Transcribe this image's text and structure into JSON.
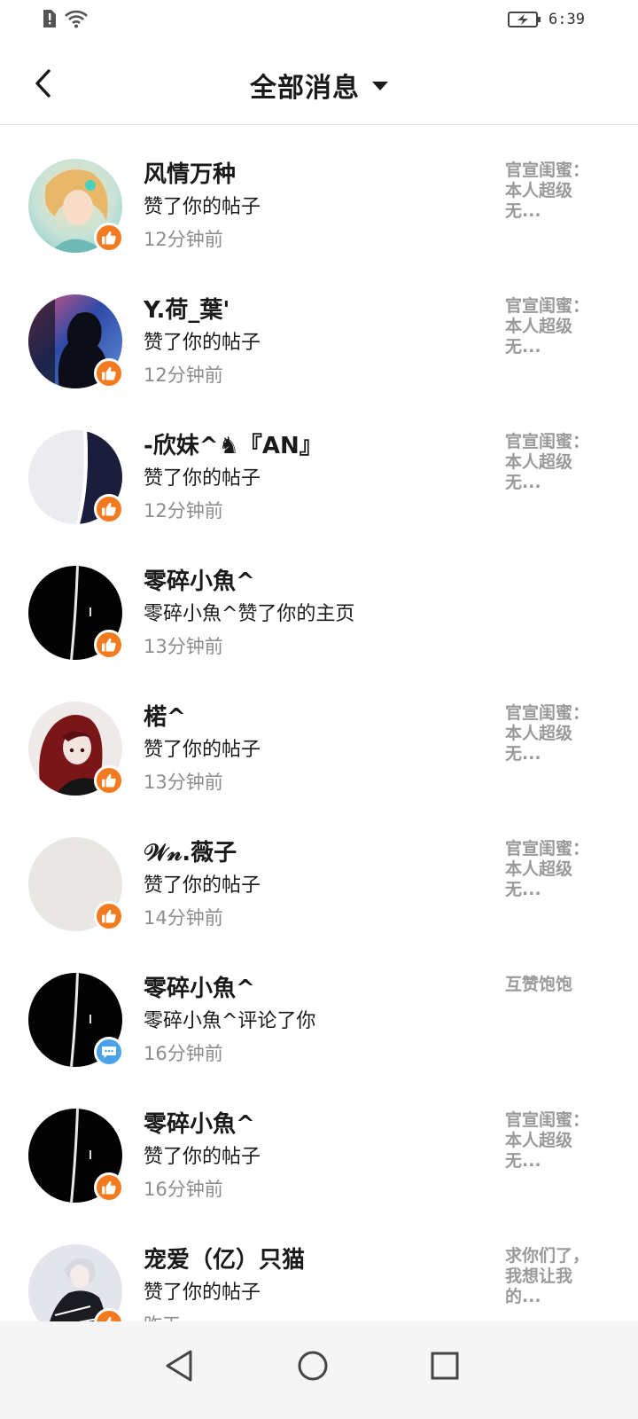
{
  "status_bar": {
    "time": "6:39"
  },
  "header": {
    "title": "全部消息"
  },
  "messages": [
    {
      "name": "风情万种",
      "action": "赞了你的帖子",
      "time": "12分钟前",
      "preview": "官宣闺蜜：本人超级无...",
      "badge": "like",
      "avatar": "anime-girl-blonde"
    },
    {
      "name": "Y.荷_葉'",
      "action": "赞了你的帖子",
      "time": "12分钟前",
      "preview": "官宣闺蜜：本人超级无...",
      "badge": "like",
      "avatar": "silhouette-dark"
    },
    {
      "name": "-欣妹^♞『AN』",
      "action": "赞了你的帖子",
      "time": "12分钟前",
      "preview": "官宣闺蜜：本人超级无...",
      "badge": "like",
      "avatar": "white-navy"
    },
    {
      "name": "零碎小魚^",
      "action": "零碎小魚^赞了你的主页",
      "time": "13分钟前",
      "preview": "",
      "badge": "like",
      "avatar": "black-stripe"
    },
    {
      "name": "楉^",
      "action": "赞了你的帖子",
      "time": "13分钟前",
      "preview": "官宣闺蜜：本人超级无...",
      "badge": "like",
      "avatar": "anime-girl-redhair"
    },
    {
      "name": "𝒲𝓃.薇子",
      "action": "赞了你的帖子",
      "time": "14分钟前",
      "preview": "官宣闺蜜：本人超级无...",
      "badge": "like",
      "avatar": "plain-gray"
    },
    {
      "name": "零碎小魚^",
      "action": "零碎小魚^评论了你",
      "time": "16分钟前",
      "preview": "互赞饱饱",
      "badge": "comment",
      "avatar": "black-stripe"
    },
    {
      "name": "零碎小魚^",
      "action": "赞了你的帖子",
      "time": "16分钟前",
      "preview": "官宣闺蜜：本人超级无...",
      "badge": "like",
      "avatar": "black-stripe"
    },
    {
      "name": "宠爱（亿）只猫",
      "action": "赞了你的帖子",
      "time": "昨天",
      "preview": "求你们了，我想让我的...",
      "badge": "like",
      "avatar": "anime-boy-white"
    }
  ],
  "colors": {
    "like_badge": "#f47a1f",
    "comment_badge": "#4aa3e8"
  },
  "icons": {
    "back": "chevron-left-icon",
    "dropdown": "caret-down-icon",
    "like": "thumbs-up-icon",
    "comment": "chat-bubble-icon"
  }
}
